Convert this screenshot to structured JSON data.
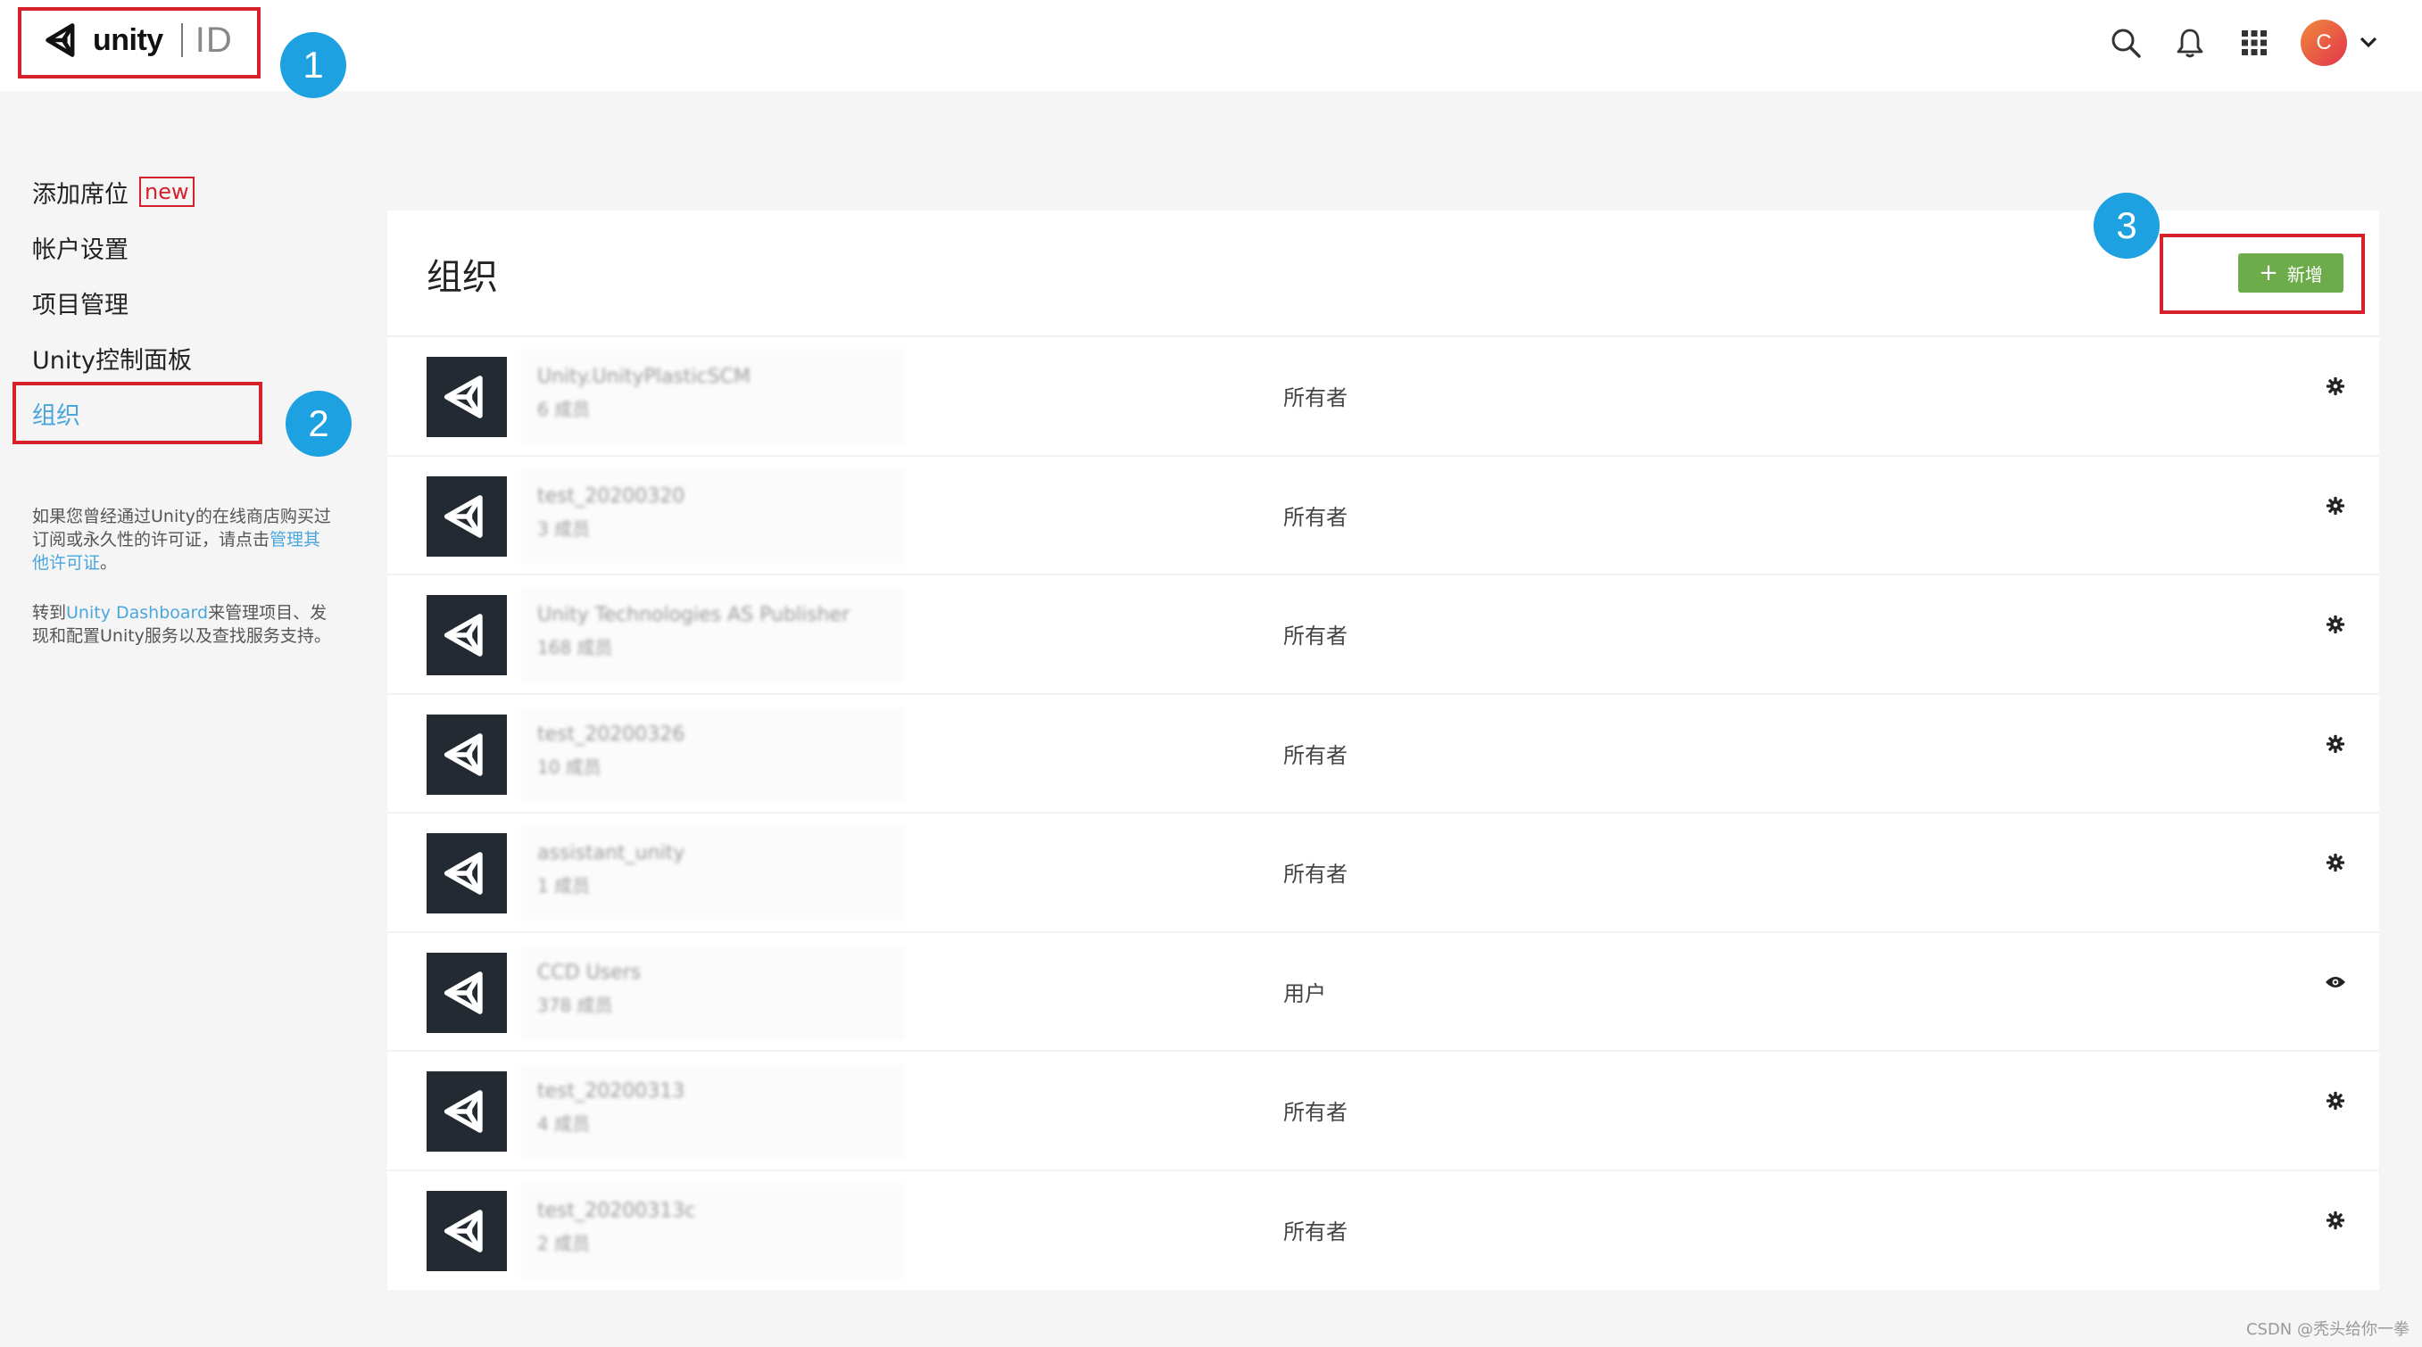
{
  "header": {
    "logo_word": "unity",
    "logo_id": "ID",
    "avatar_initial": "C",
    "icons": [
      "search-icon",
      "bell-icon",
      "apps-grid-icon",
      "chevron-down-icon"
    ]
  },
  "badges": [
    "1",
    "2",
    "3"
  ],
  "sidebar": {
    "items": [
      {
        "label": "添加席位",
        "tag": "new"
      },
      {
        "label": "帐户设置"
      },
      {
        "label": "项目管理"
      },
      {
        "label": "Unity控制面板"
      },
      {
        "label": "组织",
        "active": true
      }
    ],
    "help1": {
      "prefix": "如果您曾经通过Unity的在线商店购买过订阅或永久性的许可证，请点击",
      "link": "管理其他许可证",
      "suffix": "。"
    },
    "help2": {
      "prefix": "转到",
      "link": "Unity Dashboard",
      "suffix": "来管理项目、发现和配置Unity服务以及查找服务支持。"
    }
  },
  "main": {
    "title": "组织",
    "add_button": {
      "icon": "+",
      "label": "新增"
    },
    "organizations": [
      {
        "name": "Unity.UnityPlasticSCM",
        "members": "6 成员",
        "role": "所有者",
        "action_icon": "gear-icon"
      },
      {
        "name": "test_20200320",
        "members": "3 成员",
        "role": "所有者",
        "action_icon": "gear-icon"
      },
      {
        "name": "Unity Technologies AS Publisher",
        "members": "168 成员",
        "role": "所有者",
        "action_icon": "gear-icon"
      },
      {
        "name": "test_20200326",
        "members": "10 成员",
        "role": "所有者",
        "action_icon": "gear-icon"
      },
      {
        "name": "assistant_unity",
        "members": "1 成员",
        "role": "所有者",
        "action_icon": "gear-icon"
      },
      {
        "name": "CCD Users",
        "members": "378 成员",
        "role": "用户",
        "action_icon": "eye-icon"
      },
      {
        "name": "test_20200313",
        "members": "4 成员",
        "role": "所有者",
        "action_icon": "gear-icon"
      },
      {
        "name": "test_20200313c",
        "members": "2 成员",
        "role": "所有者",
        "action_icon": "gear-icon"
      }
    ]
  },
  "watermark": "CSDN @秃头给你一拳",
  "colors": {
    "accent_link": "#4aa6dc",
    "button_green": "#6cac4a",
    "annotation_red": "#d6202a",
    "badge_blue": "#1da1e0",
    "org_logo_bg": "#232a31"
  }
}
